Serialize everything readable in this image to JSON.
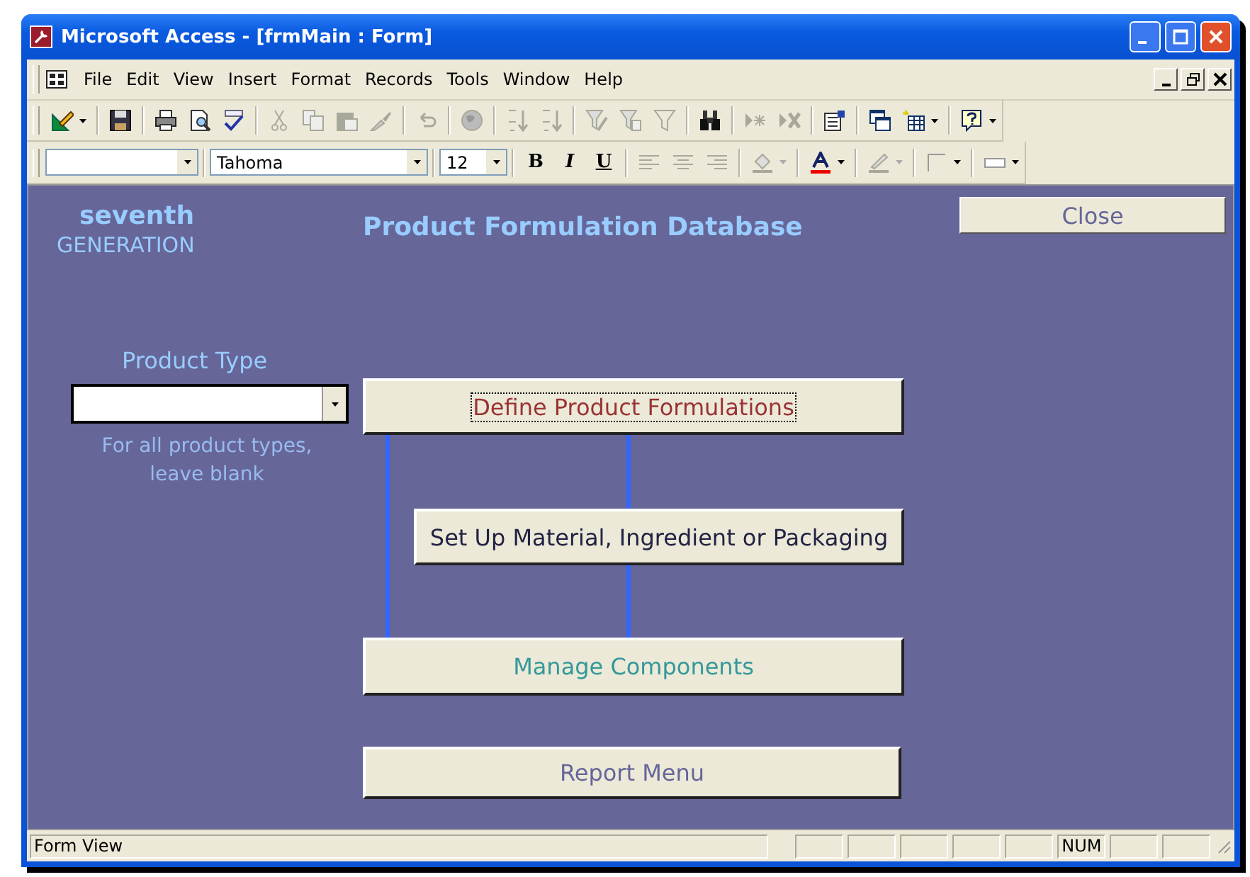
{
  "window": {
    "title": "Microsoft Access - [frmMain : Form]"
  },
  "menu": [
    {
      "label": "File"
    },
    {
      "label": "Edit"
    },
    {
      "label": "View"
    },
    {
      "label": "Insert"
    },
    {
      "label": "Format"
    },
    {
      "label": "Records"
    },
    {
      "label": "Tools"
    },
    {
      "label": "Window"
    },
    {
      "label": "Help"
    }
  ],
  "formatting_toolbar": {
    "font_field": {
      "value": "Tahoma"
    },
    "size_field": {
      "value": "12"
    },
    "style_buttons": [
      {
        "label": "B",
        "kind": "bold"
      },
      {
        "label": "I",
        "kind": "italic"
      },
      {
        "label": "U",
        "kind": "underline"
      }
    ]
  },
  "form": {
    "logo": {
      "line_1": "seventh",
      "line_2": "GENERATION"
    },
    "heading": "Product Formulation Database",
    "close_button": "Close",
    "product_type": {
      "label": "Product Type",
      "hint": "For all product types, leave blank"
    },
    "buttons": [
      {
        "label": "Define Product Formulations",
        "color": "#993333",
        "focused": true
      },
      {
        "label": "Set Up Material, Ingredient or Packaging",
        "color": "#222244",
        "focused": false
      },
      {
        "label": "Manage Components",
        "color": "#339999",
        "focused": false
      },
      {
        "label": "Report Menu",
        "color": "#666699",
        "focused": false
      }
    ]
  },
  "status_bar": {
    "text": "Form View",
    "indicators": [
      "NUM"
    ]
  }
}
